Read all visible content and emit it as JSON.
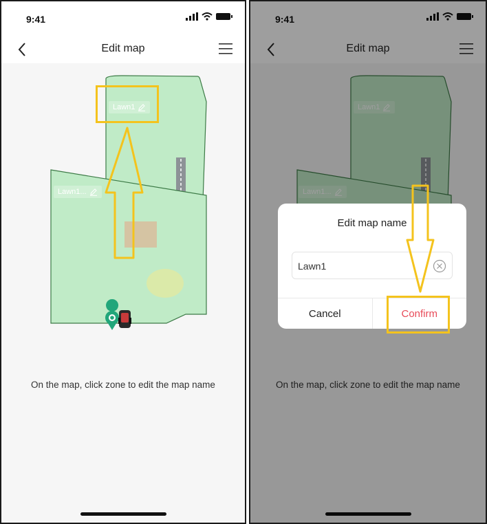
{
  "colors": {
    "zone_fill": "#c0ebc7",
    "zone_stroke": "#3c7a46",
    "annotation": "#f4c31d",
    "confirm": "#e84a58"
  },
  "left_screen": {
    "status_time": "9:41",
    "nav_title": "Edit map",
    "zones": [
      {
        "label": "Lawn1"
      },
      {
        "label": "Lawn1..."
      }
    ],
    "hint": "On the map, click zone to edit the map name"
  },
  "right_screen": {
    "status_time": "9:41",
    "nav_title": "Edit map",
    "zones": [
      {
        "label": "Lawn1"
      },
      {
        "label": "Lawn1..."
      }
    ],
    "dialog": {
      "title": "Edit map name",
      "input_value": "Lawn1",
      "cancel_label": "Cancel",
      "confirm_label": "Confirm"
    },
    "hint": "On the map, click zone to edit the map name"
  }
}
